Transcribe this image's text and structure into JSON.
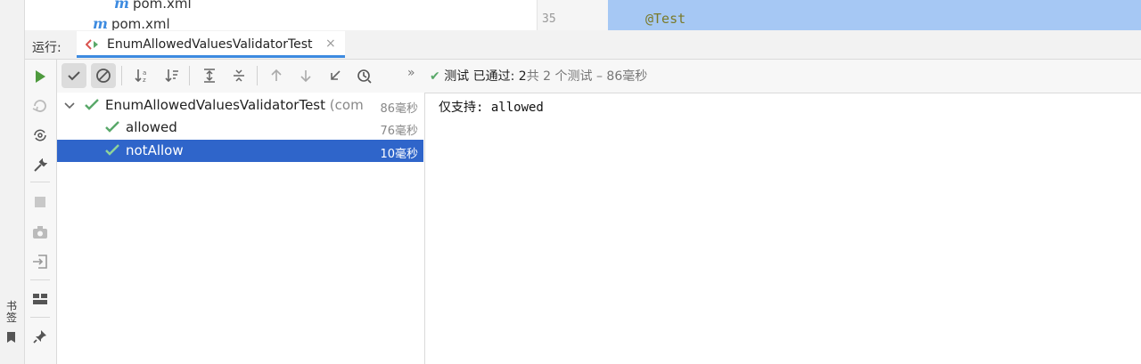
{
  "editor": {
    "project_files": [
      {
        "label": "pom.xml"
      },
      {
        "label": "pom.xml"
      }
    ],
    "line_number": "35",
    "code_annotation": "@Test"
  },
  "bookmarks_label": "书签",
  "run_panel": {
    "label": "运行:",
    "tab_title": "EnumAllowedValuesValidatorTest",
    "tab_close": "×",
    "status_check": "✔",
    "status_bold": "测试 已通过: 2",
    "status_rest": "共 2 个测试 – 86毫秒",
    "more": "»"
  },
  "test_tree": {
    "root": {
      "name": "EnumAllowedValuesValidatorTest",
      "package": "(com",
      "time": "86毫秒"
    },
    "tests": [
      {
        "name": "allowed",
        "time": "76毫秒",
        "selected": false
      },
      {
        "name": "notAllow",
        "time": "10毫秒",
        "selected": true
      }
    ]
  },
  "console_output": "仅支持: allowed",
  "colors": {
    "accent": "#3d8be0",
    "pass": "#59a869",
    "selection": "#2f65ca",
    "run": "#4e9a3e"
  }
}
